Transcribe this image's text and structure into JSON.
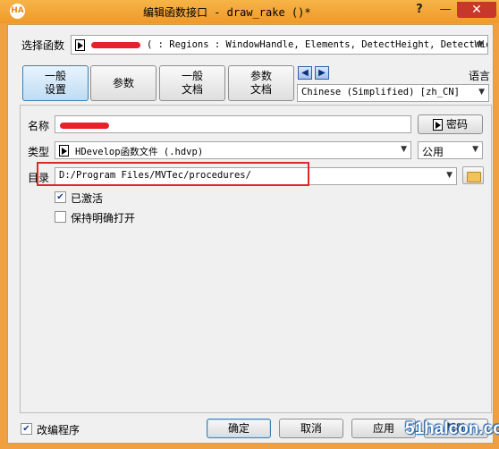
{
  "window": {
    "title": "编辑函数接口 - draw_rake ()*",
    "logo": "HA",
    "help_label": "?",
    "min_label": "—",
    "close_label": "✕"
  },
  "select_function": {
    "label": "选择函数",
    "value": "( : Regions : WindowHandle, Elements, DetectHeight, DetectWid"
  },
  "tabs": [
    {
      "label": "一般设置",
      "active": true
    },
    {
      "label": "参数",
      "active": false
    },
    {
      "label": "一般文档",
      "active": false
    },
    {
      "label": "参数文档",
      "active": false
    }
  ],
  "language": {
    "label": "语言",
    "value": "Chinese (Simplified) [zh_CN]"
  },
  "form": {
    "name_label": "名称",
    "password_label": "密码",
    "type_label": "类型",
    "type_value": "HDevelop函数文件 (.hdvp)",
    "visibility_value": "公用",
    "dir_label": "目录",
    "dir_value": "D:/Program Files/MVTec/procedures/",
    "activated_label": "已激活",
    "activated_checked": "✔",
    "keep_open_label": "保持明确打开"
  },
  "footer": {
    "modify_label": "改编程序",
    "modify_checked": "✔",
    "ok_label": "确定",
    "cancel_label": "取消",
    "apply_label": "应用",
    "help_label": "帮助"
  },
  "watermark": "51halcon.com",
  "colors": {
    "titlebar": "#f0a040",
    "close": "#c8372b",
    "highlight": "#e0252b",
    "active_tab": "#bfdcf4"
  }
}
